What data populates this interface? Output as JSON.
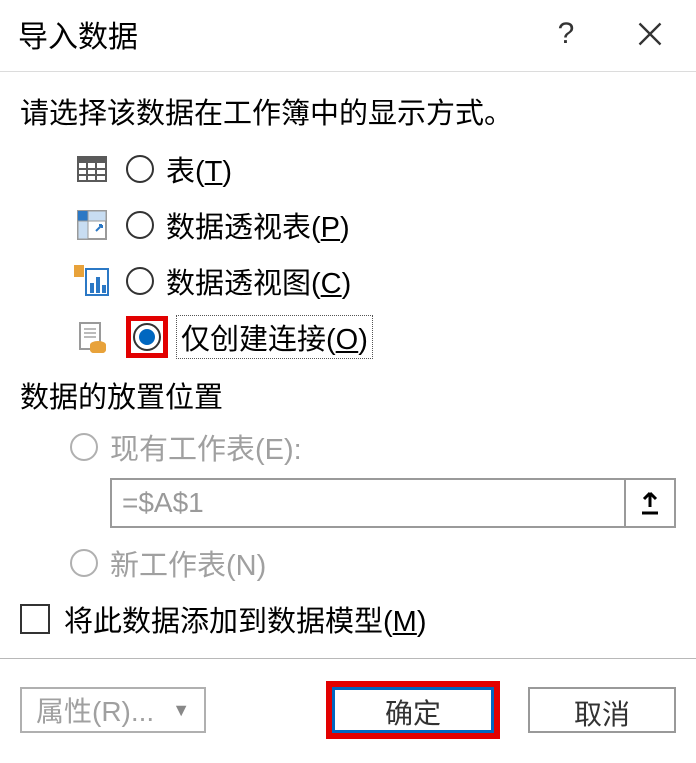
{
  "titlebar": {
    "title": "导入数据",
    "help": "?",
    "close": "×"
  },
  "prompt": "请选择该数据在工作簿中的显示方式。",
  "options": {
    "table": {
      "label": "表(",
      "accel": "T",
      "suffix": ")"
    },
    "pivot": {
      "label": "数据透视表(",
      "accel": "P",
      "suffix": ")"
    },
    "chart": {
      "label": "数据透视图(",
      "accel": "C",
      "suffix": ")"
    },
    "conn": {
      "label": "仅创建连接(",
      "accel": "O",
      "suffix": ")"
    }
  },
  "placement": {
    "title": "数据的放置位置",
    "existing": {
      "label": "现有工作表(E):"
    },
    "cell_value": "=$A$1",
    "newsheet": {
      "label": "新工作表(N)"
    }
  },
  "model": {
    "label": "将此数据添加到数据模型(",
    "accel": "M",
    "suffix": ")"
  },
  "footer": {
    "properties": "属性(R)...",
    "ok": "确定",
    "cancel": "取消"
  }
}
